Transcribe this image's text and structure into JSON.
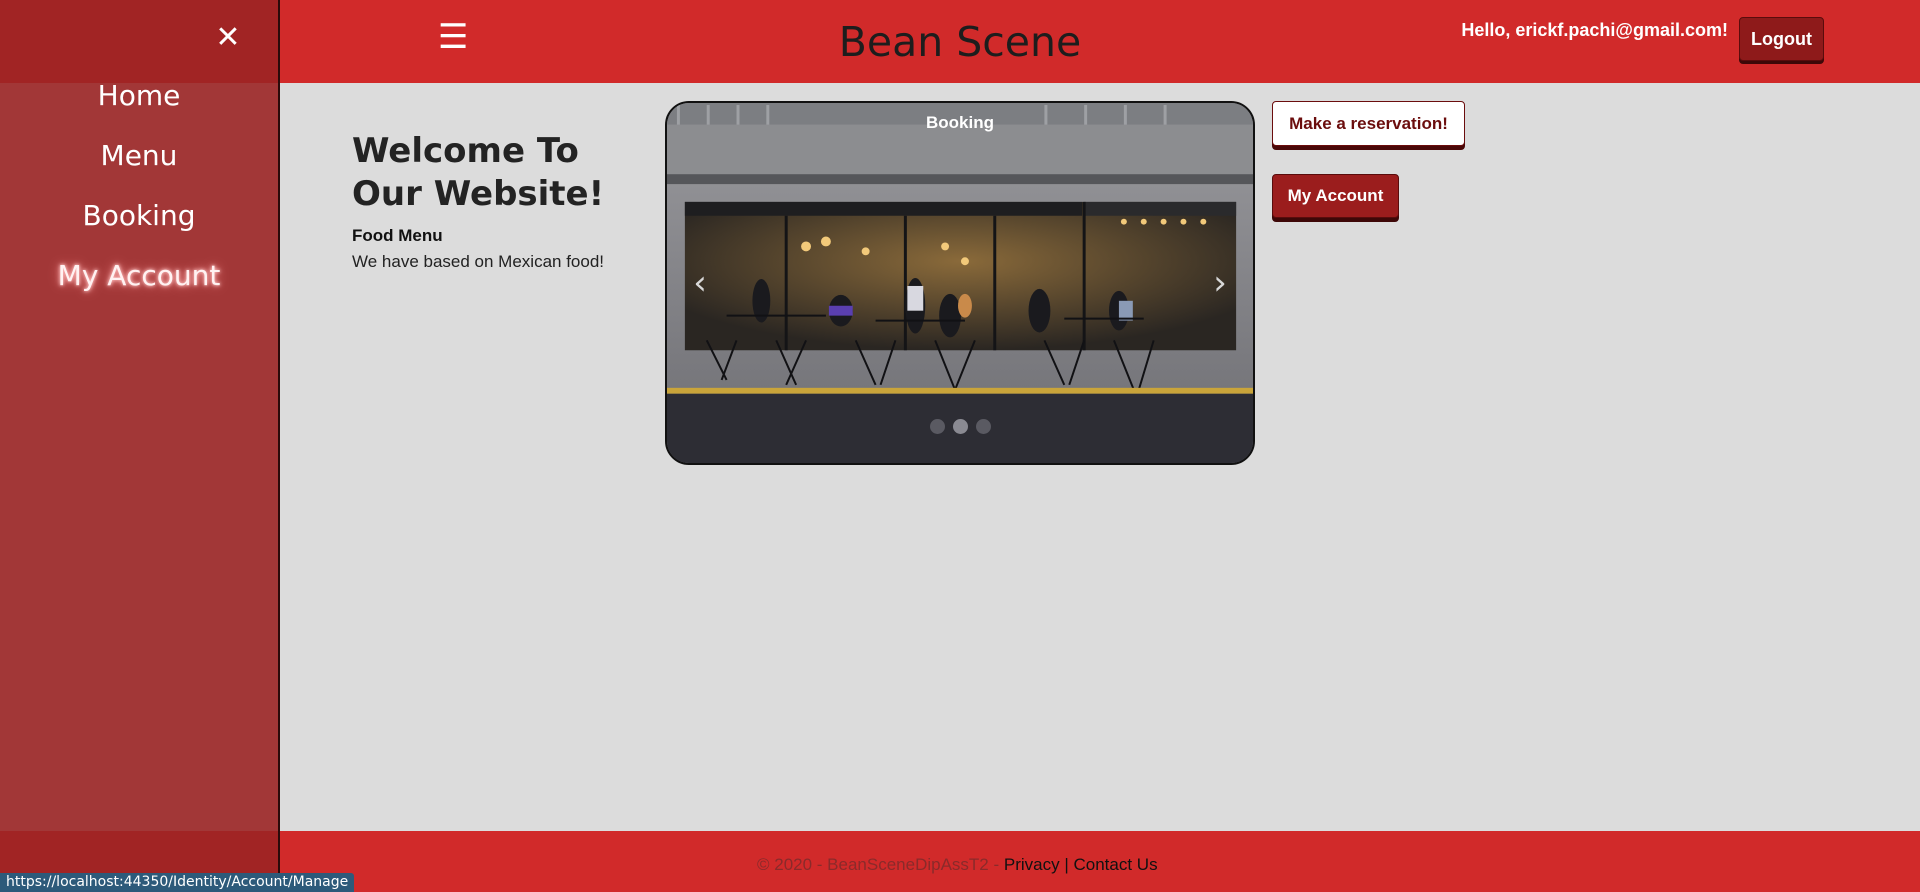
{
  "header": {
    "brand": "Bean Scene",
    "greeting": "Hello, erickf.pachi@gmail.com!",
    "logout_label": "Logout",
    "menu_icon": "hamburger-icon"
  },
  "sidebar": {
    "close_icon": "close-icon",
    "items": [
      {
        "label": "Home"
      },
      {
        "label": "Menu"
      },
      {
        "label": "Booking"
      },
      {
        "label": "My Account",
        "active": true
      }
    ]
  },
  "main": {
    "welcome_title": "Welcome To Our Website!",
    "food_heading": "Food Menu",
    "food_text": "We have based on Mexican food!"
  },
  "carousel": {
    "caption": "Booking",
    "prev_icon": "chevron-left-icon",
    "next_icon": "chevron-right-icon",
    "slide_count": 3,
    "active_slide": 2
  },
  "actions": {
    "reserve_label": "Make a reservation!",
    "account_label": "My Account"
  },
  "footer": {
    "copyright": "© 2020 - BeanSceneDipAssT2 - ",
    "privacy_label": "Privacy",
    "separator": " | ",
    "contact_label": "Contact Us"
  },
  "status_bar": {
    "url": "https://localhost:44350/Identity/Account/Manage"
  },
  "colors": {
    "header_red": "#d12a2a",
    "sidebar_red": "#a23737",
    "page_bg": "#dcdcdc",
    "button_dark_red": "#9b1d1d"
  }
}
